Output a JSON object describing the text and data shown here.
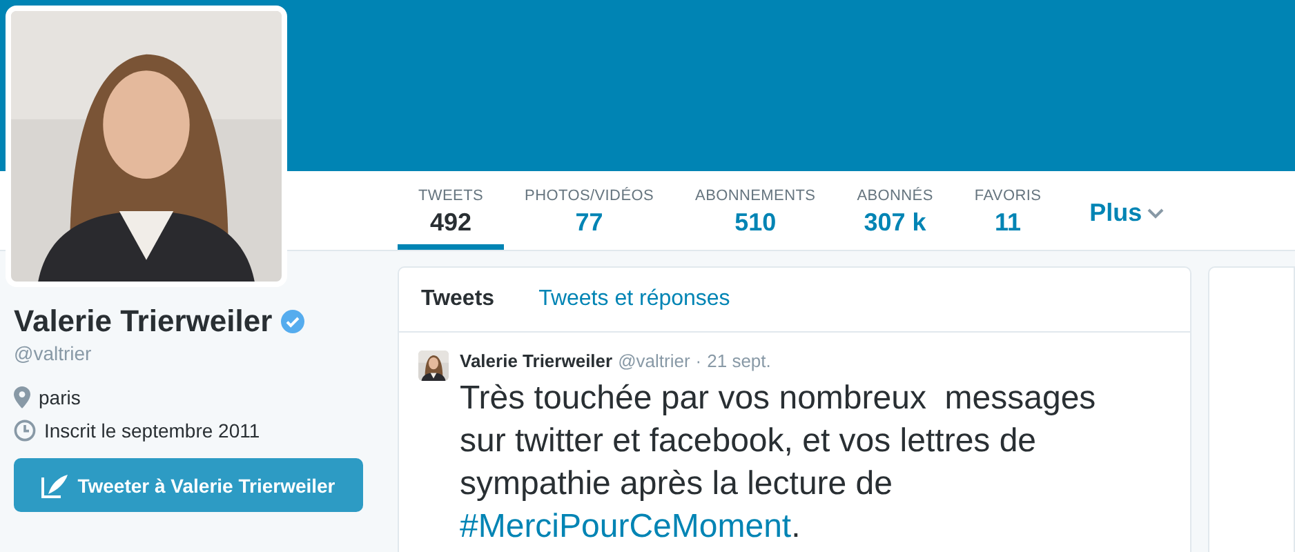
{
  "profile": {
    "name": "Valerie Trierweiler",
    "verified": true,
    "handle": "@valtrier",
    "location": "paris",
    "joined": "Inscrit le septembre 2011",
    "tweet_button": "Tweeter à Valerie Trierweiler"
  },
  "stats": [
    {
      "label": "TWEETS",
      "value": "492",
      "selected": true
    },
    {
      "label": "PHOTOS/VIDÉOS",
      "value": "77",
      "selected": false
    },
    {
      "label": "ABONNEMENTS",
      "value": "510",
      "selected": false
    },
    {
      "label": "ABONNÉS",
      "value": "307 k",
      "selected": false
    },
    {
      "label": "FAVORIS",
      "value": "11",
      "selected": false
    }
  ],
  "more": "Plus",
  "timeline_tabs": [
    {
      "label": "Tweets",
      "selected": true
    },
    {
      "label": "Tweets et réponses",
      "selected": false
    }
  ],
  "tweet": {
    "name": "Valerie Trierweiler",
    "handle": "@valtrier",
    "separator": "·",
    "date": "21 sept.",
    "text": "Très touchée par vos nombreux  messages sur twitter et facebook, et vos lettres de sympathie après la lecture de ",
    "hashtag": "#MerciPourCeMoment",
    "after": "."
  }
}
